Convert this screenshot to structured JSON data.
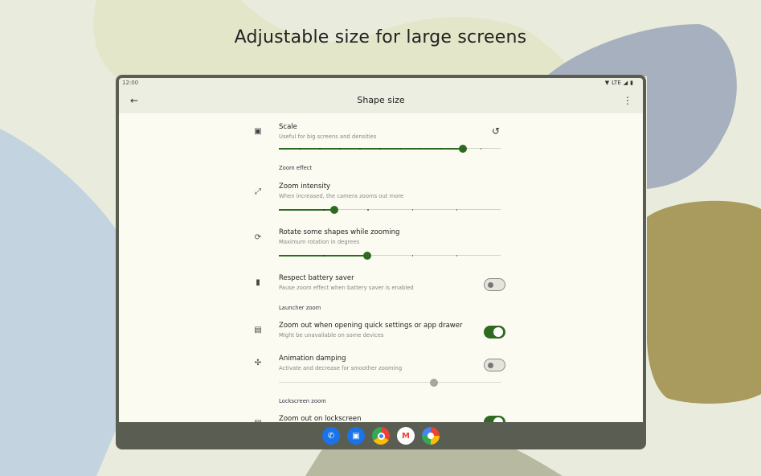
{
  "headline": "Adjustable size for large screens",
  "status_bar": {
    "time": "12:00",
    "network": "LTE"
  },
  "app_bar": {
    "title": "Shape size",
    "back_icon": "arrow-left-icon",
    "menu_icon": "more-vert-icon"
  },
  "settings": {
    "scale": {
      "title": "Scale",
      "subtitle": "Useful for big screens and densities",
      "value_fraction": 0.83,
      "ticks": 11
    },
    "zoom_effect_header": "Zoom effect",
    "zoom_intensity": {
      "title": "Zoom intensity",
      "subtitle": "When increased, the camera zooms out more",
      "value_fraction": 0.25,
      "ticks": 5
    },
    "rotate_shapes": {
      "title": "Rotate some shapes while zooming",
      "subtitle": "Maximum rotation in degrees",
      "value_fraction": 0.4,
      "ticks": 5
    },
    "battery_saver": {
      "title": "Respect battery saver",
      "subtitle": "Pause zoom effect when battery saver is enabled",
      "enabled": false
    },
    "launcher_zoom_header": "Launcher zoom",
    "quick_settings": {
      "title": "Zoom out when opening quick settings or app drawer",
      "subtitle": "Might be unavailable on some devices",
      "enabled": true
    },
    "animation_damping": {
      "title": "Animation damping",
      "subtitle": "Activate and decrease for smoother zooming",
      "enabled": false,
      "value_fraction": 0.7
    },
    "lockscreen_zoom_header": "Lockscreen zoom",
    "lockscreen": {
      "title": "Zoom out on lockscreen",
      "enabled": true
    }
  },
  "dock_apps": [
    "phone",
    "messages",
    "chrome",
    "gmail",
    "photos"
  ],
  "colors": {
    "accent": "#2e6a1f",
    "surface": "#fbfbf2",
    "frame": "#5a5d52"
  }
}
